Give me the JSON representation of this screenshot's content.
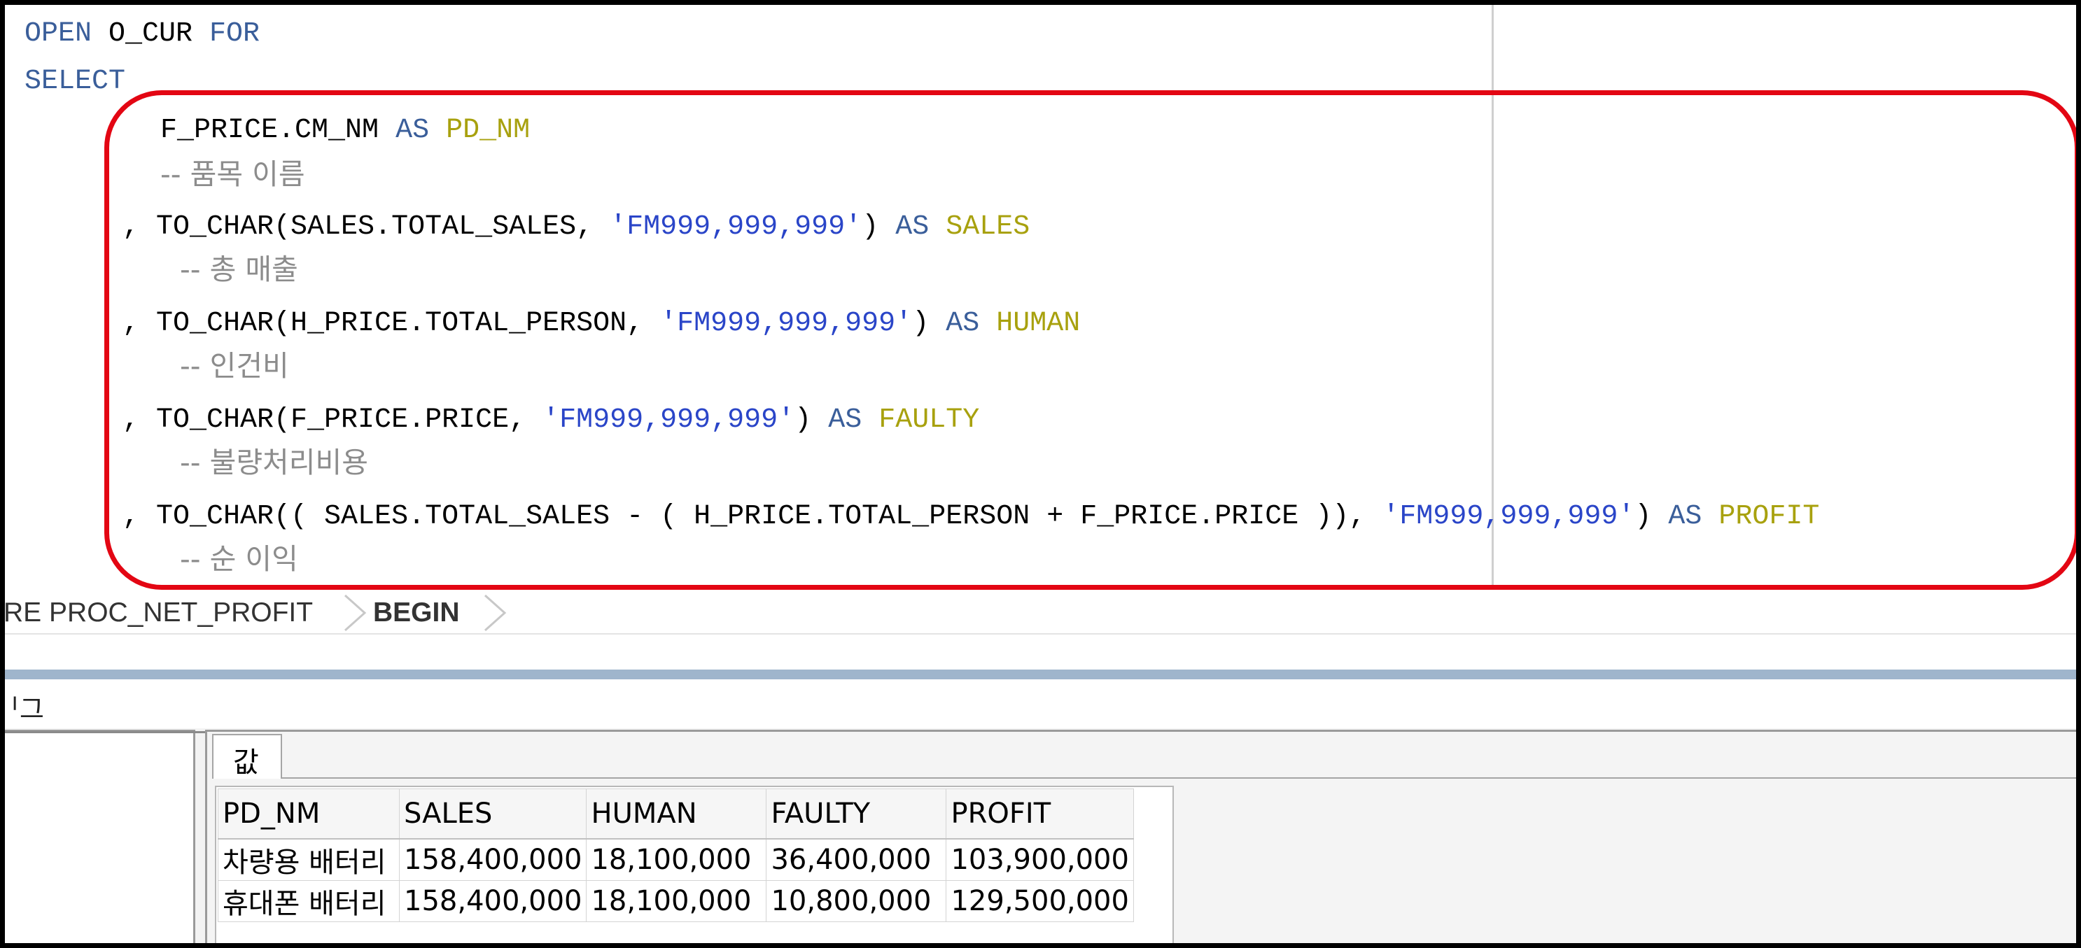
{
  "editor": {
    "lines": {
      "open_kw": "OPEN",
      "open_cursor": " O_CUR ",
      "open_for": "FOR",
      "select": "SELECT",
      "l3_expr": "F_PRICE.CM_NM ",
      "l3_as": "AS",
      "l3_alias": " PD_NM",
      "l4_comment": "-- 품목 이름",
      "l5_expr": ", TO_CHAR(SALES.TOTAL_SALES, ",
      "l5_fmt": "'FM999,999,999'",
      "l5_close": ") ",
      "l5_as": "AS",
      "l5_alias": " SALES",
      "l6_comment": "-- 총 매출",
      "l7_expr": ", TO_CHAR(H_PRICE.TOTAL_PERSON, ",
      "l7_fmt": "'FM999,999,999'",
      "l7_close": ") ",
      "l7_as": "AS",
      "l7_alias": " HUMAN",
      "l8_comment": "-- 인건비",
      "l9_expr": ", TO_CHAR(F_PRICE.PRICE, ",
      "l9_fmt": "'FM999,999,999'",
      "l9_close": ") ",
      "l9_as": "AS",
      "l9_alias": " FAULTY",
      "l10_comment": "-- 불량처리비용",
      "l11_expr": ", TO_CHAR(( SALES.TOTAL_SALES - ( H_PRICE.TOTAL_PERSON + F_PRICE.PRICE )), ",
      "l11_fmt": "'FM999,999,999'",
      "l11_close": ") ",
      "l11_as": "AS",
      "l11_alias": " PROFIT",
      "l12_comment": "-- 순 이익"
    },
    "colors": {
      "keyword": "#3a5e9a",
      "alias": "#a8a10e",
      "string": "#2a45c8",
      "comment": "#8c8c8c",
      "highlight": "#e30613"
    }
  },
  "breadcrumb": {
    "item1": "RE PROC_NET_PROFIT",
    "item2": "BEGIN"
  },
  "panel": {
    "title": "ᅵ그"
  },
  "results": {
    "tab_label": "값",
    "columns": [
      "PD_NM",
      "SALES",
      "HUMAN",
      "FAULTY",
      "PROFIT"
    ],
    "rows": [
      [
        "차량용 배터리",
        "158,400,000",
        "18,100,000",
        "36,400,000",
        "103,900,000"
      ],
      [
        "휴대폰 배터리",
        "158,400,000",
        "18,100,000",
        "10,800,000",
        "129,500,000"
      ]
    ]
  }
}
